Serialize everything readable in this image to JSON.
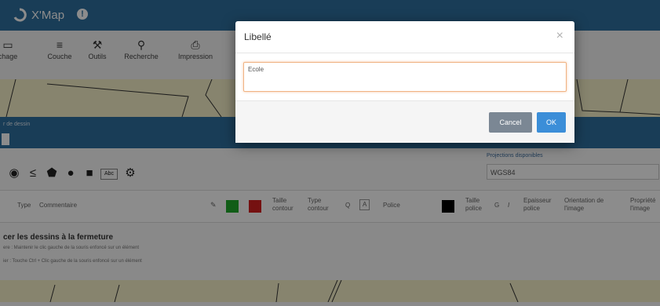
{
  "app": {
    "title": "X'Map",
    "help_icon": "!",
    "toolbar": [
      {
        "label": "chage",
        "icon": "monitor-icon",
        "glyph": "▭"
      },
      {
        "label": "Couche",
        "icon": "menu-icon",
        "glyph": "≡"
      },
      {
        "label": "Outils",
        "icon": "wrench-icon",
        "glyph": "⚒"
      },
      {
        "label": "Recherche",
        "icon": "search-icon",
        "glyph": "⚲"
      },
      {
        "label": "Impression",
        "icon": "print-icon",
        "glyph": "⎙"
      }
    ],
    "panel_bar_label": "r de dessin",
    "shapes": [
      {
        "name": "target-shape",
        "glyph": "◉"
      },
      {
        "name": "polyline-shape",
        "glyph": "≤"
      },
      {
        "name": "polygon-shape",
        "glyph": "⬟"
      },
      {
        "name": "circle-shape",
        "glyph": "●"
      },
      {
        "name": "square-shape",
        "glyph": "■"
      },
      {
        "name": "text-shape",
        "glyph": "Abc"
      },
      {
        "name": "symbol-shape",
        "glyph": "⚙"
      }
    ],
    "projection": {
      "label": "Projections disponibles",
      "value": "WGS84"
    },
    "table_headers": {
      "type": "Type",
      "comment": "Commentaire",
      "edit": "✎",
      "contour_size": "Taille contour",
      "contour_type": "Type contour",
      "q": "Q",
      "police": "Police",
      "police_size": "Taille police",
      "g": "G",
      "i": "I",
      "police_thickness": "Epaisseur police",
      "image_orientation": "Orientation de l'image",
      "image_prop": "Propriété l'image"
    },
    "colors": {
      "green": "#1faa2a",
      "red": "#d61f1f",
      "black": "#000000"
    },
    "close_note": "cer les dessins à la fermeture",
    "notes": [
      "ere : Maintenir le clic gauche de la souris enfoncé sur un élément",
      "ier : Touche Ctrl + Clic gauche de la souris enfoncé sur un élément"
    ]
  },
  "modal": {
    "title": "Libellé",
    "close_icon": "×",
    "input_value": "Ecole",
    "cancel_label": "Cancel",
    "ok_label": "OK"
  }
}
